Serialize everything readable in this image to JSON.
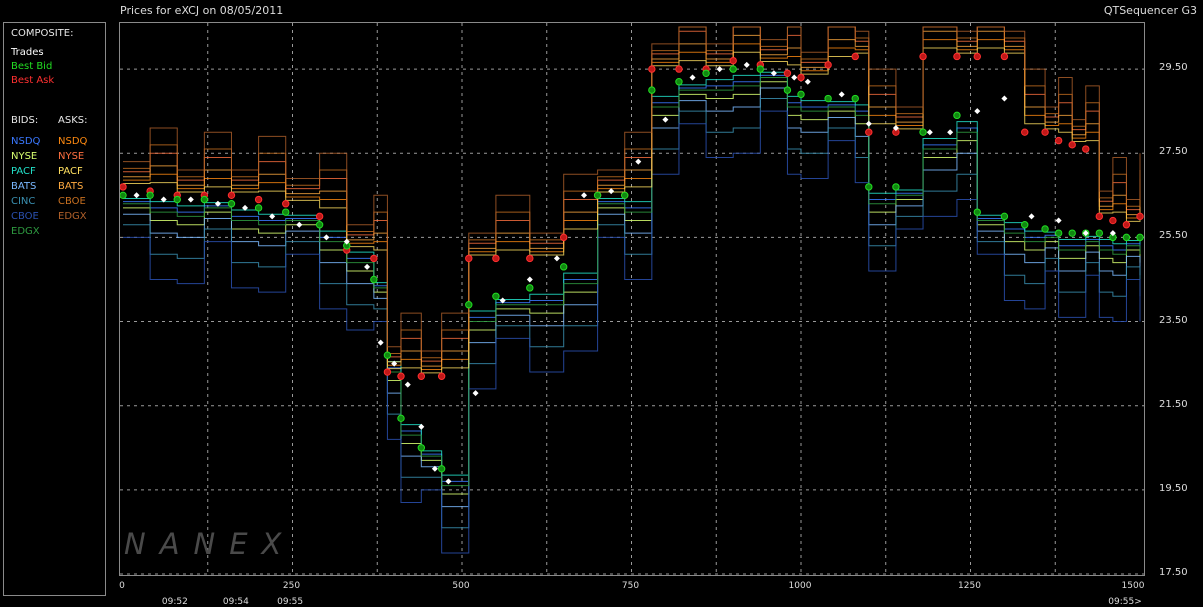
{
  "header": {
    "title": "Prices for  eXCJ  on  08/05/2011",
    "app_name": "QTSequencer G3"
  },
  "legend": {
    "composite_title": "COMPOSITE:",
    "composite": [
      {
        "label": "Trades",
        "color": "#ffffff"
      },
      {
        "label": "Best Bid",
        "color": "#22dd22"
      },
      {
        "label": "Best Ask",
        "color": "#ff3030"
      }
    ],
    "bids_title": "BIDS:",
    "asks_title": "ASKS:",
    "bids": [
      {
        "label": "NSDQ",
        "color": "#3a78ff"
      },
      {
        "label": "NYSE",
        "color": "#d8ff70"
      },
      {
        "label": "PACF",
        "color": "#22e0c8"
      },
      {
        "label": "BATS",
        "color": "#7ab8ff"
      },
      {
        "label": "CINC",
        "color": "#3a8fb0"
      },
      {
        "label": "CBOE",
        "color": "#2a50b0"
      },
      {
        "label": "EDGX",
        "color": "#2e9a40"
      }
    ],
    "asks": [
      {
        "label": "NSDQ",
        "color": "#ff8a10"
      },
      {
        "label": "NYSE",
        "color": "#ff7040"
      },
      {
        "label": "PACF",
        "color": "#ffe060"
      },
      {
        "label": "BATS",
        "color": "#ffaa40"
      },
      {
        "label": "CBOE",
        "color": "#c87020"
      },
      {
        "label": "EDGX",
        "color": "#b0602a"
      }
    ]
  },
  "watermark": "NANEX",
  "chart_data": {
    "type": "line",
    "ylim": [
      17.5,
      30.5
    ],
    "xlim": [
      0,
      1500
    ],
    "yticks": [
      "29.50",
      "27.50",
      "25.50",
      "23.50",
      "21.50",
      "19.50",
      "17.50"
    ],
    "ytick_values": [
      29.5,
      27.5,
      25.5,
      23.5,
      21.5,
      19.5,
      17.5
    ],
    "xticks": [
      "0",
      "250",
      "500",
      "750",
      "1000",
      "1250",
      "1500"
    ],
    "xtick_values": [
      0,
      250,
      500,
      750,
      1000,
      1250,
      1500
    ],
    "time_labels": [
      {
        "label": "09:52",
        "x": 78
      },
      {
        "label": "09:54",
        "x": 168
      },
      {
        "label": "09:55",
        "x": 248
      },
      {
        "label": "09:55>",
        "x": 1500
      }
    ],
    "grid": true,
    "series": [
      {
        "name": "Best Ask",
        "color": "#ff3030",
        "kind": "markers",
        "x": [
          0,
          40,
          80,
          120,
          160,
          200,
          240,
          290,
          330,
          370,
          390,
          410,
          440,
          470,
          510,
          550,
          600,
          650,
          700,
          740,
          780,
          820,
          860,
          900,
          940,
          980,
          1000,
          1040,
          1080,
          1100,
          1140,
          1180,
          1230,
          1260,
          1300,
          1330,
          1360,
          1380,
          1400,
          1420,
          1440,
          1460,
          1480,
          1500
        ],
        "y": [
          26.7,
          26.6,
          26.5,
          26.5,
          26.5,
          26.4,
          26.3,
          26.0,
          25.2,
          25.0,
          22.3,
          22.2,
          22.2,
          22.2,
          25.0,
          25.0,
          25.0,
          25.5,
          26.5,
          26.5,
          29.5,
          29.5,
          29.5,
          29.7,
          29.6,
          29.4,
          29.3,
          29.6,
          29.8,
          28.0,
          28.0,
          29.8,
          29.8,
          29.8,
          29.8,
          28.0,
          28.0,
          27.8,
          27.7,
          27.6,
          26.0,
          25.9,
          25.8,
          26.0
        ]
      },
      {
        "name": "Best Bid",
        "color": "#22dd22",
        "kind": "markers",
        "x": [
          0,
          40,
          80,
          120,
          160,
          200,
          240,
          290,
          330,
          370,
          390,
          410,
          440,
          470,
          510,
          550,
          600,
          650,
          700,
          740,
          780,
          820,
          860,
          900,
          940,
          980,
          1000,
          1040,
          1080,
          1100,
          1140,
          1180,
          1230,
          1260,
          1300,
          1330,
          1360,
          1380,
          1400,
          1420,
          1440,
          1460,
          1480,
          1500
        ],
        "y": [
          26.5,
          26.5,
          26.4,
          26.4,
          26.3,
          26.2,
          26.1,
          25.8,
          25.3,
          24.5,
          22.7,
          21.2,
          20.5,
          20.0,
          23.9,
          24.1,
          24.3,
          24.8,
          26.5,
          26.5,
          29.0,
          29.2,
          29.4,
          29.5,
          29.5,
          29.0,
          28.9,
          28.8,
          28.8,
          26.7,
          26.7,
          28.0,
          28.4,
          26.1,
          26.0,
          25.8,
          25.7,
          25.6,
          25.6,
          25.6,
          25.6,
          25.5,
          25.5,
          25.5
        ]
      },
      {
        "name": "Trades",
        "color": "#ffffff",
        "kind": "markers",
        "x": [
          20,
          60,
          100,
          140,
          180,
          220,
          260,
          300,
          330,
          360,
          380,
          400,
          420,
          440,
          460,
          480,
          520,
          560,
          600,
          640,
          680,
          720,
          760,
          800,
          840,
          880,
          920,
          960,
          990,
          1010,
          1060,
          1100,
          1140,
          1190,
          1220,
          1260,
          1300,
          1340,
          1380,
          1420,
          1460
        ],
        "y": [
          26.5,
          26.4,
          26.4,
          26.3,
          26.2,
          26.0,
          25.8,
          25.5,
          25.4,
          24.8,
          23.0,
          22.5,
          22.0,
          21.0,
          20.0,
          19.7,
          21.8,
          24.0,
          24.5,
          25.0,
          26.5,
          26.6,
          27.3,
          28.3,
          29.3,
          29.5,
          29.6,
          29.4,
          29.3,
          29.2,
          28.9,
          28.2,
          28.1,
          28.0,
          28.0,
          28.5,
          28.8,
          26.0,
          25.9,
          25.6,
          25.6
        ]
      }
    ]
  }
}
